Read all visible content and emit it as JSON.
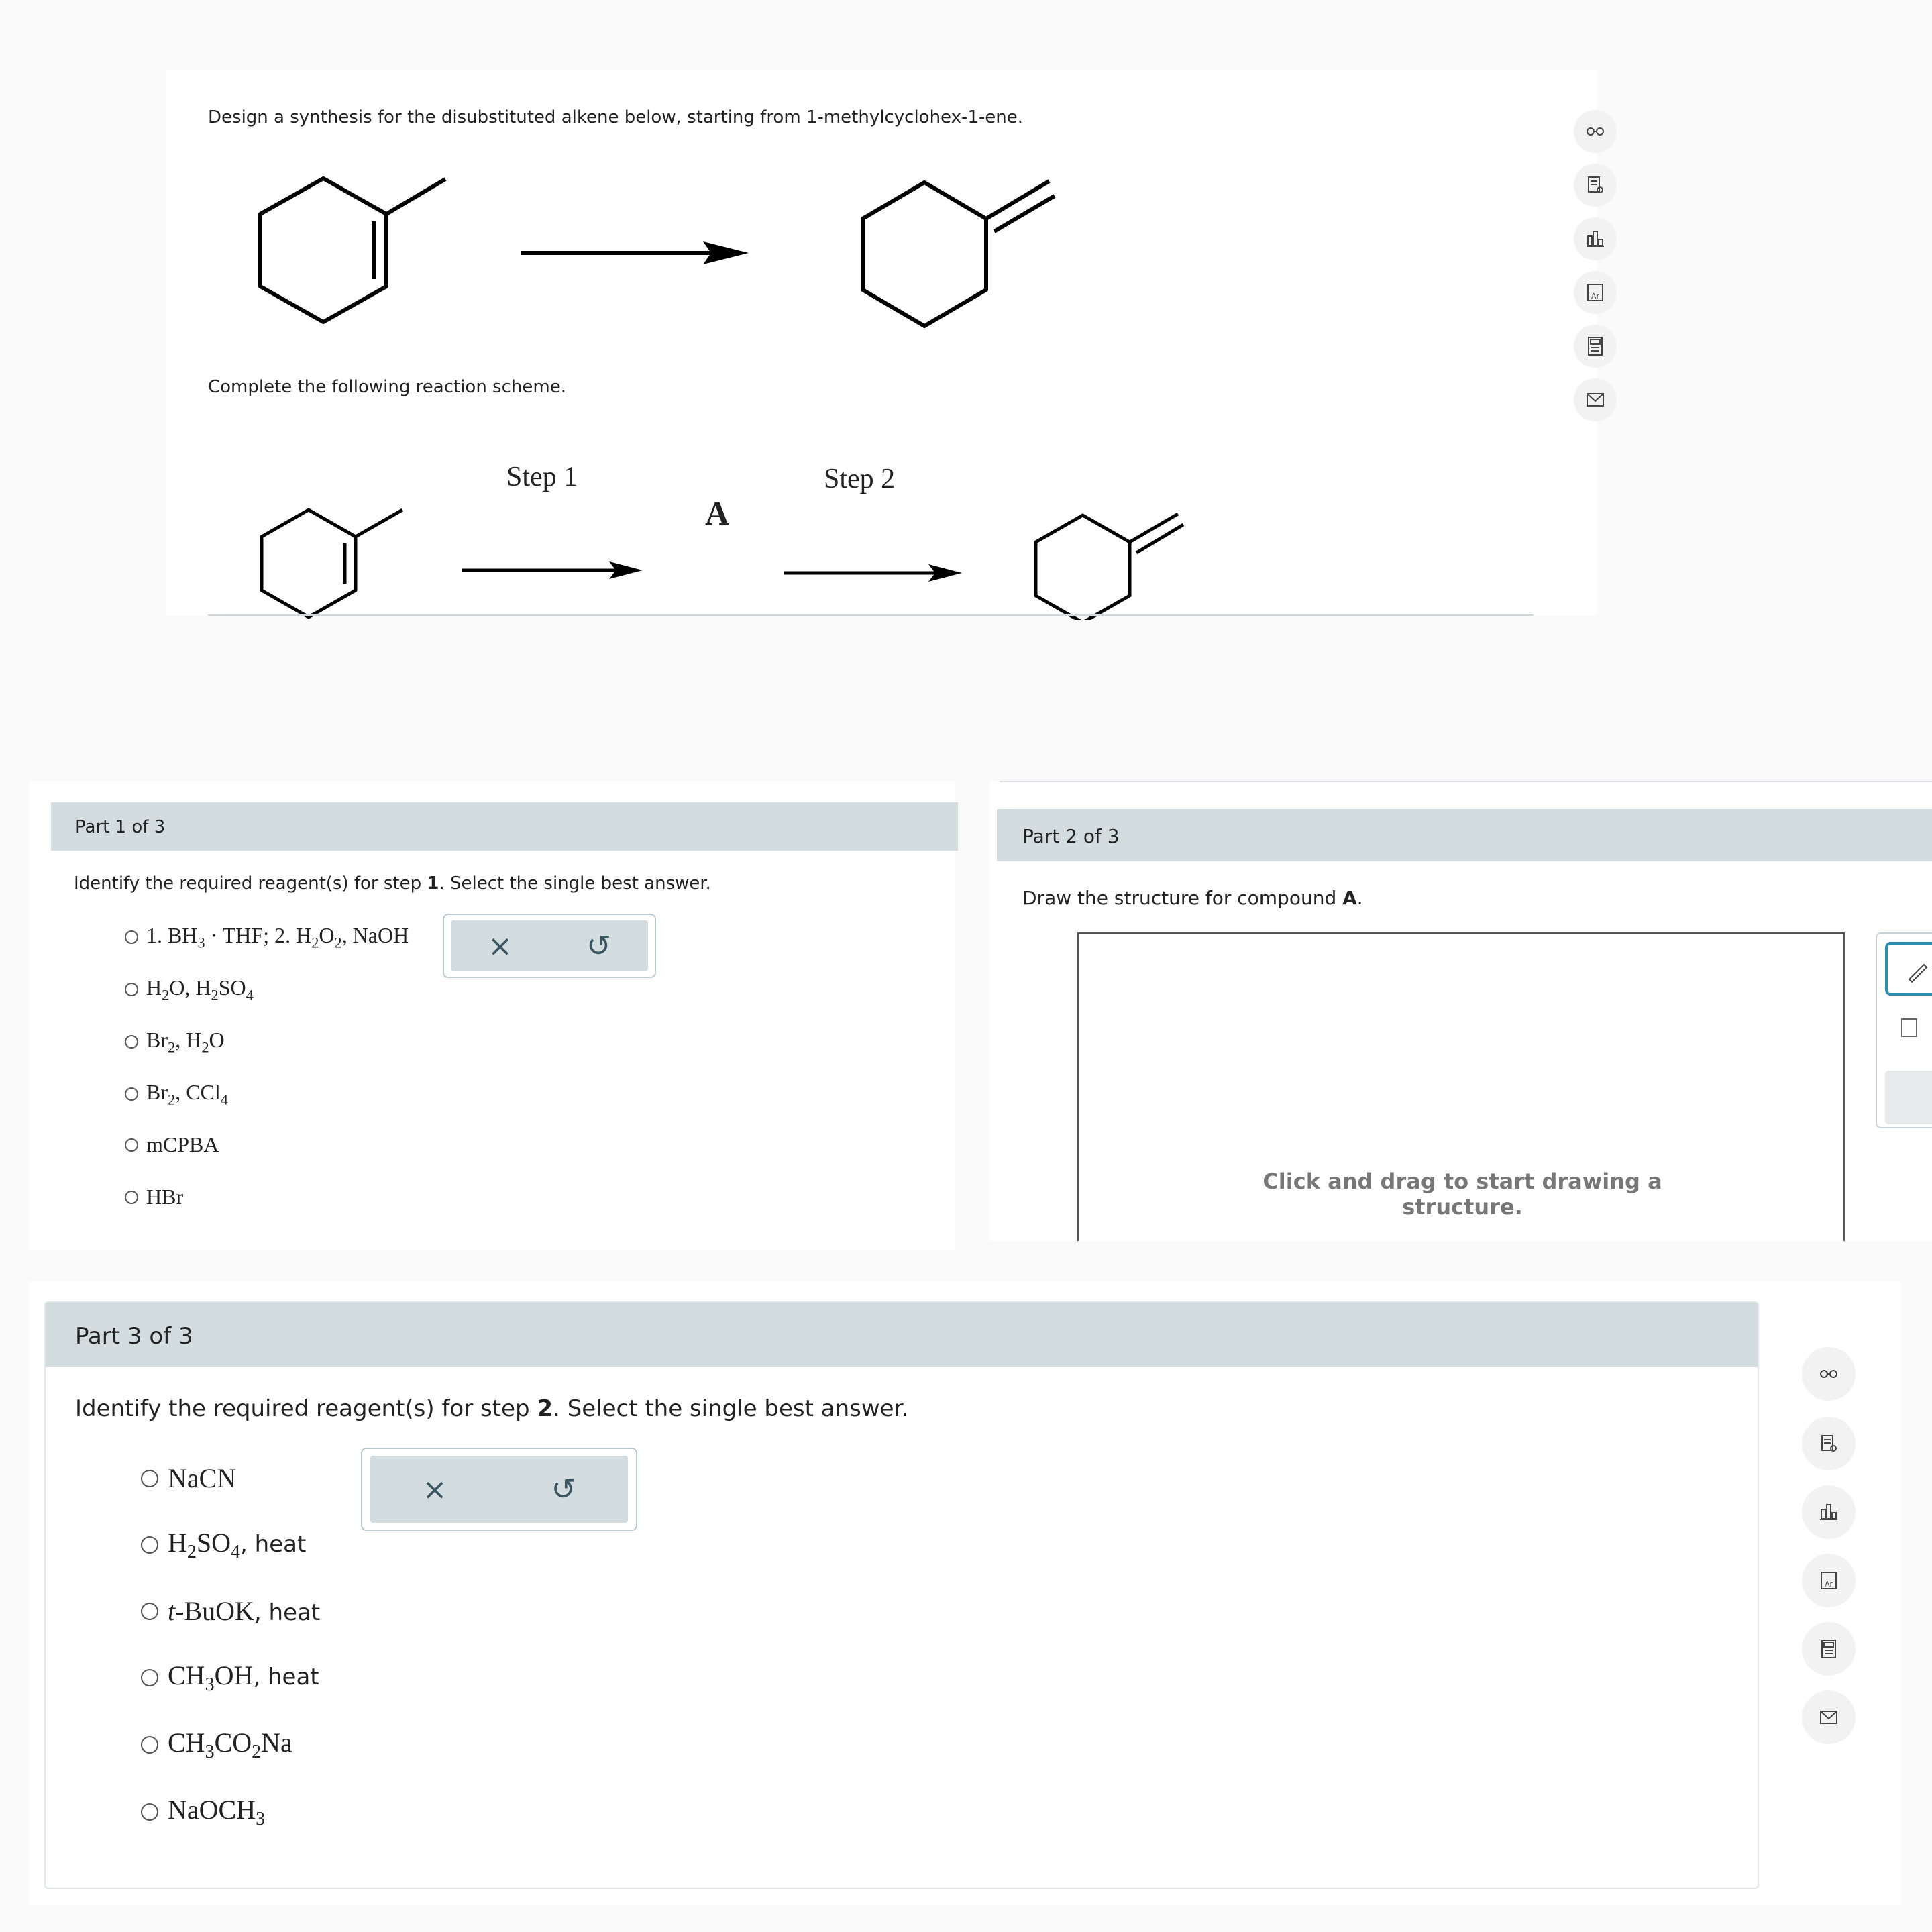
{
  "question": {
    "intro_text": "Design a synthesis for the disubstituted alkene below, starting from 1-methylcyclohex-1-ene.",
    "scheme_text": "Complete the following reaction scheme.",
    "step1_label": "Step 1",
    "step2_label": "Step 2",
    "intermediate_label": "A"
  },
  "toolbar": {
    "icons": [
      "glasses-icon",
      "notes-icon",
      "chart-icon",
      "periodic-table-icon",
      "calculator-icon",
      "mail-icon"
    ]
  },
  "part1": {
    "header": "Part 1 of 3",
    "prompt_pre": "Identify the required reagent(s) for step ",
    "prompt_step": "1",
    "prompt_post": ". Select the single best answer.",
    "options": [
      "1. BH3 · THF; 2. H2O2, NaOH",
      "H2O, H2SO4",
      "Br2, H2O",
      "Br2, CCl4",
      "mCPBA",
      "HBr"
    ],
    "clear_symbol": "×",
    "undo_symbol": "↺"
  },
  "part2": {
    "header": "Part 2 of 3",
    "prompt_pre": "Draw the structure for compound ",
    "prompt_bold": "A",
    "prompt_post": ".",
    "canvas_hint": "Click and drag to start drawing a structure."
  },
  "part3": {
    "header": "Part 3 of 3",
    "prompt_pre": "Identify the required reagent(s) for step ",
    "prompt_step": "2",
    "prompt_post": ". Select the single best answer.",
    "options": [
      "NaCN",
      "H2SO4, heat",
      "t-BuOK, heat",
      "CH3OH, heat",
      "CH3CO2Na",
      "NaOCH3"
    ],
    "clear_symbol": "×",
    "undo_symbol": "↺"
  }
}
